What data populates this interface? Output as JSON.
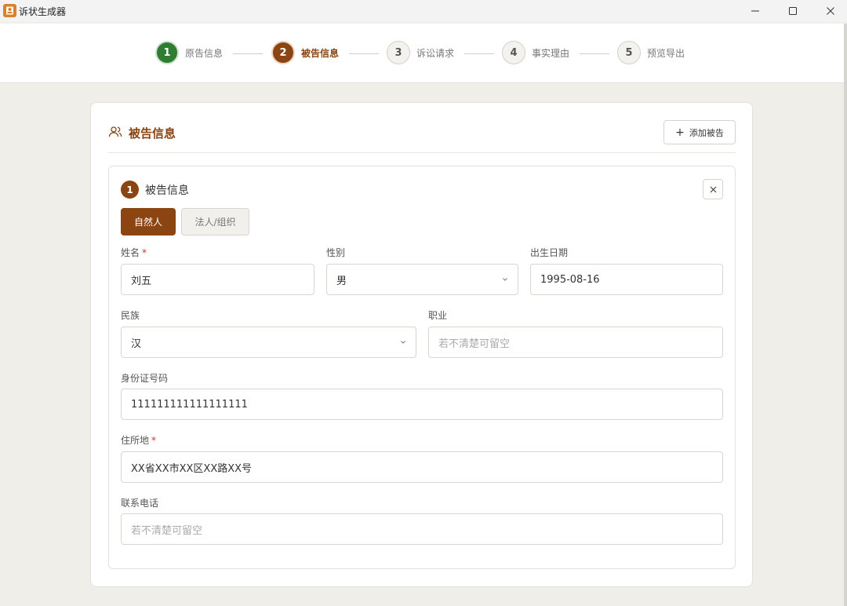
{
  "window": {
    "title": "诉状生成器"
  },
  "steps": [
    {
      "number": "1",
      "label": "原告信息",
      "state": "done"
    },
    {
      "number": "2",
      "label": "被告信息",
      "state": "active"
    },
    {
      "number": "3",
      "label": "诉讼请求",
      "state": "todo"
    },
    {
      "number": "4",
      "label": "事实理由",
      "state": "todo"
    },
    {
      "number": "5",
      "label": "预览导出",
      "state": "todo"
    }
  ],
  "section": {
    "title": "被告信息",
    "add_button": "添加被告"
  },
  "defendant": {
    "number": "1",
    "title": "被告信息",
    "type_natural": "自然人",
    "type_legal": "法人/组织",
    "fields": {
      "name": {
        "label": "姓名",
        "required": "*",
        "value": "刘五"
      },
      "gender": {
        "label": "性别",
        "value": "男"
      },
      "birth": {
        "label": "出生日期",
        "value": "1995-08-16"
      },
      "ethnicity": {
        "label": "民族",
        "value": "汉"
      },
      "occupation": {
        "label": "职业",
        "placeholder": "若不清楚可留空"
      },
      "id_number": {
        "label": "身份证号码",
        "value": "111111111111111111"
      },
      "address": {
        "label": "住所地",
        "required": "*",
        "value": "XX省XX市XX区XX路XX号"
      },
      "phone": {
        "label": "联系电话",
        "placeholder": "若不清楚可留空"
      }
    }
  },
  "colors": {
    "accent": "#8b4513",
    "done": "#2e7d32",
    "background": "#efeee8"
  }
}
